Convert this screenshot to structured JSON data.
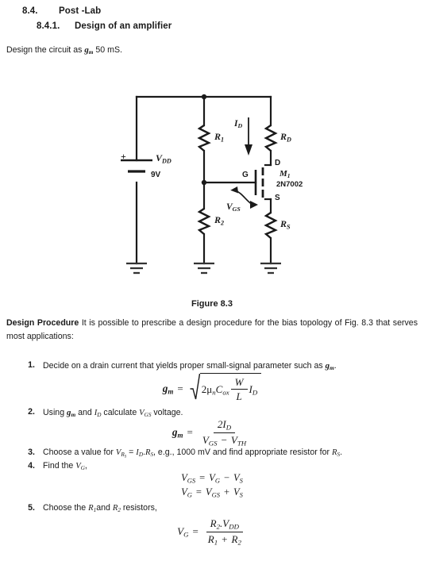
{
  "document": {
    "section_heading": {
      "number": "8.4.",
      "title": "Post -Lab"
    },
    "subsection_heading": {
      "number": "8.4.1.",
      "title": "Design of an amplifier"
    },
    "intro": {
      "before": "Design the circuit as ",
      "symbol": "g",
      "symbol_sub": "m",
      "after": " 50 mS."
    },
    "figure_caption": "Figure 8.3",
    "procedure": {
      "lead_bold": "Design Procedure",
      "lead_text": " It is possible to prescribe a design procedure for the bias topology of Fig. 8.3 that serves most applications:"
    },
    "steps": [
      {
        "number": "1.",
        "text_before": "Decide on a drain current that yields proper small-signal parameter such as ",
        "symbol": "g",
        "symbol_sub": "m",
        "text_after": "."
      },
      {
        "number": "2.",
        "t1": "Using ",
        "s1": "g",
        "s1sub": "m",
        "t2": " and ",
        "s2": "I",
        "s2sub": "D",
        "t3": " calculate ",
        "s3": "V",
        "s3sub": "GS",
        "t4": " voltage."
      },
      {
        "number": "3.",
        "t1": "Choose a value for ",
        "s1": "V",
        "s1sub": "R",
        "s1subsub": "S",
        "t2": " = ",
        "s2": "I",
        "s2sub": "D",
        "t3": ".",
        "s3": "R",
        "s3sub": "S",
        "t4": ", e.g., 1000 mV and find appropriate resistor for ",
        "s4": "R",
        "s4sub": "S",
        "t5": "."
      },
      {
        "number": "4.",
        "t1": "Find the ",
        "s1": "V",
        "s1sub": "G",
        "t2": ","
      },
      {
        "number": "5.",
        "t1": "Choose the ",
        "s1": "R",
        "s1sub": "1",
        "t2": "and ",
        "s2": "R",
        "s2sub": "2",
        "t3": " resistors,"
      }
    ],
    "equations": {
      "eq1": {
        "lhs": "g",
        "lhs_sub": "m",
        "eq": "=",
        "radicand_prefix": "2",
        "mu": "μ",
        "mu_sub": "n",
        "cox": "C",
        "cox_sub": "ox",
        "frac_num": "W",
        "frac_den": "L",
        "tail": "I",
        "tail_sub": "D"
      },
      "eq2": {
        "lhs": "g",
        "lhs_sub": "m",
        "eq": "=",
        "num": "2I",
        "num_sub": "D",
        "den_a": "V",
        "den_a_sub": "GS",
        "den_op": "−",
        "den_b": "V",
        "den_b_sub": "TH"
      },
      "eq3": {
        "line1": "V GS = V G − V S",
        "line2": "V G = V GS + V S",
        "l1_a": "V",
        "l1_a_sub": "GS",
        "l1_eq": "=",
        "l1_b": "V",
        "l1_b_sub": "G",
        "l1_op": "−",
        "l1_c": "V",
        "l1_c_sub": "S",
        "l2_a": "V",
        "l2_a_sub": "G",
        "l2_eq": "=",
        "l2_b": "V",
        "l2_b_sub": "GS",
        "l2_op": "+",
        "l2_c": "V",
        "l2_c_sub": "S"
      },
      "eq4": {
        "lhs": "V",
        "lhs_sub": "G",
        "eq": "=",
        "num_a": "R",
        "num_a_sub": "2",
        "num_dot": ".",
        "num_b": "V",
        "num_b_sub": "DD",
        "den_a": "R",
        "den_a_sub": "1",
        "den_op": "+",
        "den_b": "R",
        "den_b_sub": "2"
      }
    }
  },
  "circuit": {
    "labels": {
      "vdd": "V",
      "vdd_sub": "DD",
      "vdd_value": "9V",
      "plus": "+",
      "r1": "R",
      "r1_sub": "1",
      "r2": "R",
      "r2_sub": "2",
      "rd": "R",
      "rd_sub": "D",
      "rs": "R",
      "rs_sub": "S",
      "id": "I",
      "id_sub": "D",
      "vgs": "V",
      "vgs_sub": "GS",
      "gate": "G",
      "drain": "D",
      "source": "S",
      "m1": "M",
      "m1_sub": "1",
      "part_number": "2N7002"
    },
    "colors": {
      "wire": "#1a1a1a",
      "label": "#1a1a1a",
      "background": "#ffffff"
    }
  }
}
